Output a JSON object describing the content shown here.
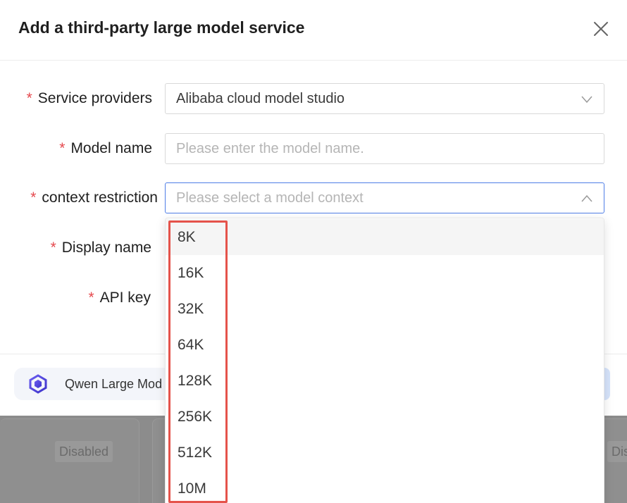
{
  "modal": {
    "title": "Add a third-party large model service"
  },
  "form": {
    "service_providers": {
      "label": "Service providers",
      "value": "Alibaba cloud model studio"
    },
    "model_name": {
      "label": "Model name",
      "placeholder": "Please enter the model name."
    },
    "context_restriction": {
      "label": "context restriction",
      "placeholder": "Please select a model context"
    },
    "display_name": {
      "label": "Display name"
    },
    "api_key": {
      "label": "API key"
    },
    "required_mark": "*"
  },
  "dropdown": {
    "options": [
      "8K",
      "16K",
      "32K",
      "64K",
      "128K",
      "256K",
      "512K",
      "10M"
    ],
    "hovered_index": 0
  },
  "footer": {
    "provider_chip_text": "Qwen Large Mod"
  },
  "background": {
    "badges": [
      "Disabled",
      "Dis"
    ]
  },
  "colors": {
    "required": "#e5484d",
    "focus_border": "#4f7ee6",
    "highlight": "#e5534b"
  },
  "icons": {
    "close": "close-icon",
    "select_down": "chevron-down-icon",
    "select_up": "chevron-up-icon",
    "provider": "qwen-logo-icon"
  }
}
